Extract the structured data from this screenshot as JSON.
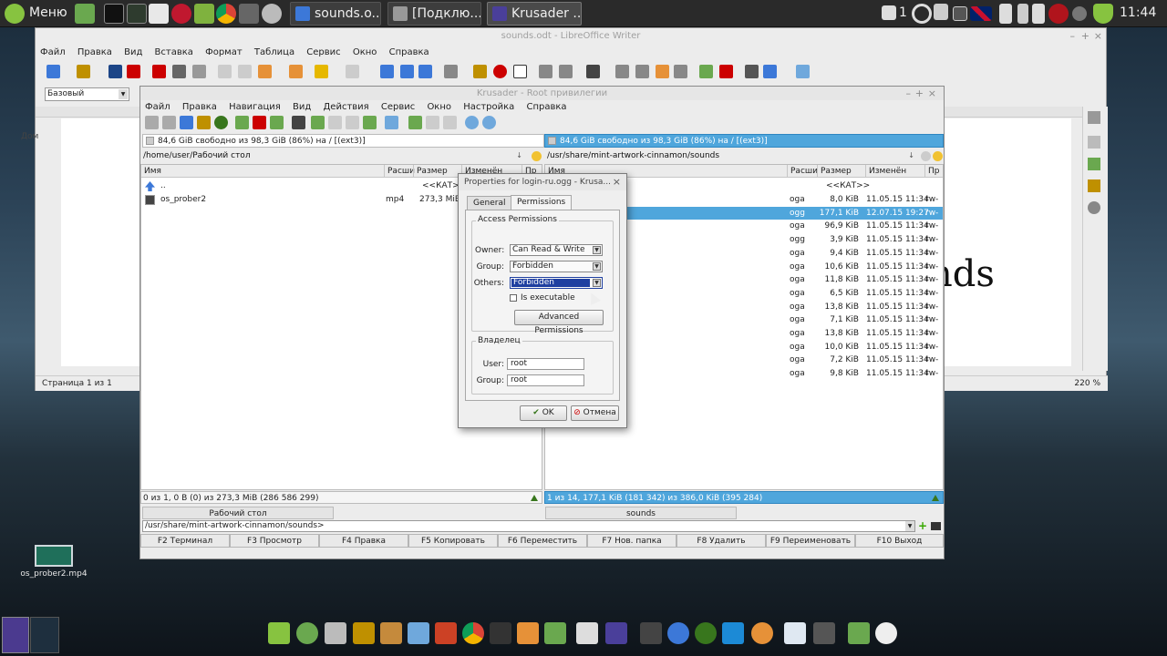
{
  "top_panel": {
    "menu_label": "Меню",
    "tasks": [
      {
        "label": "sounds.o..."
      },
      {
        "label": "[Подклю..."
      },
      {
        "label": "Krusader ..."
      }
    ],
    "notifications_count": "1",
    "clock": "11:44",
    "keyboard_layout_icon": "uk-flag-icon"
  },
  "libreoffice": {
    "title": "sounds.odt - LibreOffice Writer",
    "menu": [
      "Файл",
      "Правка",
      "Вид",
      "Вставка",
      "Формат",
      "Таблица",
      "Сервис",
      "Окно",
      "Справка"
    ],
    "style_value": "Базовый",
    "document_text": "nds",
    "left_label": "Дом",
    "status_page": "Страница 1 из 1",
    "zoom": "220 %"
  },
  "krusader": {
    "title": "Krusader - Root привилегии",
    "menu": [
      "Файл",
      "Правка",
      "Навигация",
      "Вид",
      "Действия",
      "Сервис",
      "Окно",
      "Настройка",
      "Справка"
    ],
    "left": {
      "free_space": "84,6 GiB свободно из 98,3 GiB (86%) на / [(ext3)]",
      "path": "/home/user/Рабочий стол",
      "columns": [
        "Имя",
        "Расши",
        "Размер",
        "Изменён",
        "Пр"
      ],
      "rows": [
        {
          "name": "..",
          "ext": "",
          "size": "<<КАТ>>"
        },
        {
          "name": "os_prober2",
          "ext": "mp4",
          "size": "273,3 MiB"
        }
      ],
      "status": "0 из 1, 0 B (0) из 273,3 MiB (286 586 299)",
      "tab": "Рабочий стол"
    },
    "right": {
      "free_space": "84,6 GiB свободно из 98,3 GiB (86%) на / [(ext3)]",
      "path": "/usr/share/mint-artwork-cinnamon/sounds",
      "columns": [
        "Имя",
        "Расши",
        "Размер",
        "Изменён",
        "Пр"
      ],
      "parent_size": "<<КАТ>>",
      "rows": [
        {
          "ext": "oga",
          "size": "8,0 KiB",
          "date": "11.05.15 11:34",
          "perm": "rw-",
          "selected": false
        },
        {
          "ext": "ogg",
          "size": "177,1 KiB",
          "date": "12.07.15 19:27",
          "perm": "rw-",
          "selected": true
        },
        {
          "ext": "oga",
          "size": "96,9 KiB",
          "date": "11.05.15 11:34",
          "perm": "rw-",
          "selected": false
        },
        {
          "ext": "ogg",
          "size": "3,9 KiB",
          "date": "11.05.15 11:34",
          "perm": "rw-",
          "selected": false
        },
        {
          "ext": "oga",
          "size": "9,4 KiB",
          "date": "11.05.15 11:34",
          "perm": "rw-",
          "selected": false
        },
        {
          "ext": "oga",
          "size": "10,6 KiB",
          "date": "11.05.15 11:34",
          "perm": "rw-",
          "selected": false
        },
        {
          "ext": "oga",
          "size": "11,8 KiB",
          "date": "11.05.15 11:34",
          "perm": "rw-",
          "selected": false
        },
        {
          "ext": "oga",
          "size": "6,5 KiB",
          "date": "11.05.15 11:34",
          "perm": "rw-",
          "selected": false
        },
        {
          "ext": "oga",
          "size": "13,8 KiB",
          "date": "11.05.15 11:34",
          "perm": "rw-",
          "selected": false
        },
        {
          "ext": "oga",
          "size": "7,1 KiB",
          "date": "11.05.15 11:34",
          "perm": "rw-",
          "selected": false
        },
        {
          "ext": "oga",
          "size": "13,8 KiB",
          "date": "11.05.15 11:34",
          "perm": "rw-",
          "selected": false
        },
        {
          "ext": "oga",
          "size": "10,0 KiB",
          "date": "11.05.15 11:34",
          "perm": "rw-",
          "selected": false
        },
        {
          "ext": "oga",
          "size": "7,2 KiB",
          "date": "11.05.15 11:34",
          "perm": "rw-",
          "selected": false
        },
        {
          "ext": "oga",
          "size": "9,8 KiB",
          "date": "11.05.15 11:34",
          "perm": "rw-",
          "selected": false
        }
      ],
      "status": "1 из 14, 177,1 KiB (181 342) из 386,0 KiB (395 284)",
      "tab": "sounds"
    },
    "cmdline": "/usr/share/mint-artwork-cinnamon/sounds>",
    "fkeys": [
      "F2 Терминал",
      "F3 Просмотр",
      "F4 Правка",
      "F5 Копировать",
      "F6 Переместить",
      "F7 Нов. папка",
      "F8 Удалить",
      "F9 Переименовать",
      "F10 Выход"
    ]
  },
  "dialog": {
    "title": "Properties for login-ru.ogg - Krusa...",
    "tabs": [
      "General",
      "Permissions"
    ],
    "active_tab": "Permissions",
    "access_group": "Access Permissions",
    "owner_label": "Owner:",
    "owner_value": "Can Read & Write",
    "group_label": "Group:",
    "group_value": "Forbidden",
    "others_label": "Others:",
    "others_value": "Forbidden",
    "executable_label": "Is executable",
    "executable_checked": false,
    "advanced_button": "Advanced Permissions",
    "owner_group": "Владелец",
    "user_label": "User:",
    "user_value": "root",
    "group2_label": "Group:",
    "group2_value": "root",
    "ok": "OK",
    "cancel": "Отмена"
  },
  "desktop": {
    "file_label": "os_prober2.mp4"
  },
  "colors": {
    "selection": "#4fa6dc",
    "panel_bg": "#2a2a2a",
    "combo_focus": "#1f3fa0"
  }
}
